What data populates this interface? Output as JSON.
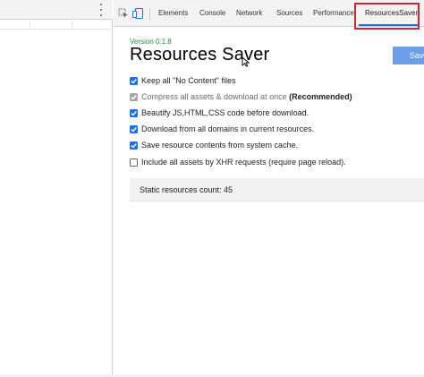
{
  "devtools": {
    "tabs": [
      {
        "label": "Elements",
        "active": false
      },
      {
        "label": "Console",
        "active": false
      },
      {
        "label": "Network",
        "active": false
      },
      {
        "label": "Sources",
        "active": false
      },
      {
        "label": "Performance",
        "active": false
      },
      {
        "label": "ResourcesSaver",
        "active": true
      }
    ],
    "icons": [
      "inspect-icon",
      "device-toolbar-icon",
      "more-options-icon"
    ],
    "highlight_color": "#d0262e",
    "active_tab_color": "#1a73e8"
  },
  "extension": {
    "version": "Version 0.1.8",
    "title": "Resources Saver",
    "save_button_label": "Save",
    "version_color": "#1e8e3e",
    "button_color": "#6d9eeb",
    "options": [
      {
        "label": "Keep all \"No Content\" files",
        "state": "checked"
      },
      {
        "label": "Compress all assets & download at once ",
        "strong": "(Recommended)",
        "state": "checked-disabled"
      },
      {
        "label": "Beautify JS,HTML,CSS code before download.",
        "state": "checked"
      },
      {
        "label": "Download from all domains in current resources.",
        "state": "checked"
      },
      {
        "label": "Save resource contents from system cache.",
        "state": "checked"
      },
      {
        "label": "Include all assets by XHR requests (require page reload).",
        "state": "unchecked"
      }
    ],
    "status": "Static resources count: 45"
  }
}
